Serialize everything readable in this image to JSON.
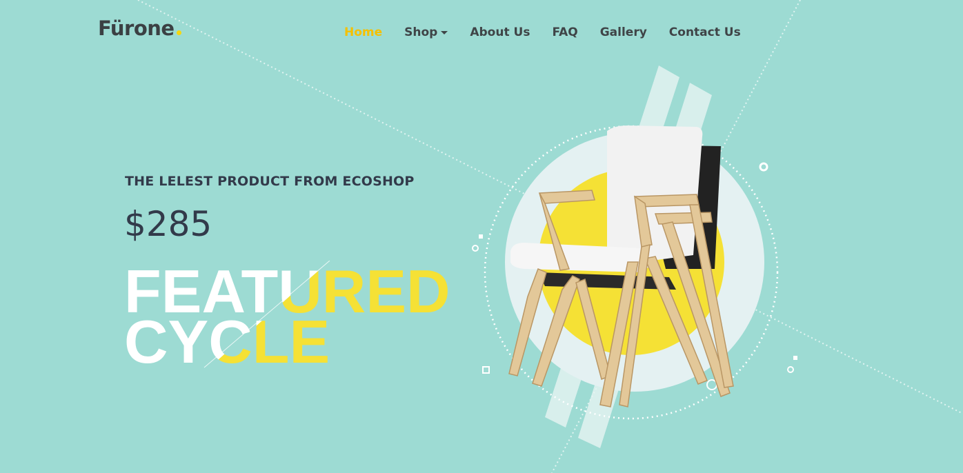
{
  "brand": {
    "name": "Fürone"
  },
  "nav": {
    "items": [
      {
        "label": "Home",
        "active": true
      },
      {
        "label": "Shop",
        "has_dropdown": true
      },
      {
        "label": "About Us"
      },
      {
        "label": "FAQ"
      },
      {
        "label": "Gallery"
      },
      {
        "label": "Contact Us"
      }
    ]
  },
  "hero": {
    "subtitle": "THE LELEST PRODUCT FROM ECOSHOP",
    "price": "$285",
    "headline_line1": "FEATURED",
    "headline_line2": "CYCLE",
    "image": "chair-icon"
  },
  "colors": {
    "background": "#9ddbd3",
    "accent": "#f5d70f",
    "text_dark": "#323a4a",
    "nav_active": "#f5c000"
  }
}
